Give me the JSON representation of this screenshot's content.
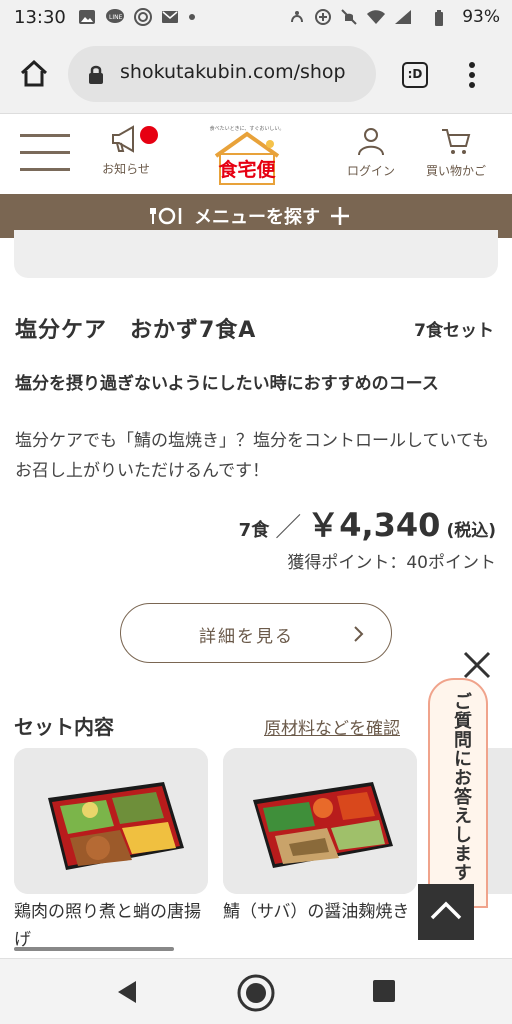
{
  "status_bar": {
    "time": "13:30",
    "battery": "93%"
  },
  "browser": {
    "url": "shokutakubin.com/shop",
    "tabs_label": ":D"
  },
  "header": {
    "notice_label": "お知らせ",
    "logo_text": "食宅便",
    "logo_tagline": "食べたいときに、すぐおいしい。",
    "login_label": "ログイン",
    "cart_label": "買い物かご",
    "menu_search_label": "メニューを探す"
  },
  "product": {
    "title": "塩分ケア　おかず7食A",
    "set_count": "7食セット",
    "lead": "塩分を摂り過ぎないようにしたい時におすすめのコース",
    "description": "塩分ケアでも「鯖の塩焼き」？塩分をコントロールしていてもお召し上がりいただけるんです！",
    "price_qty": "7食",
    "price_slash": "／",
    "price": "￥4,340",
    "price_tax": "(税込)",
    "points": "獲得ポイント：40ポイント",
    "detail_button": "詳細を見る"
  },
  "set_contents": {
    "title": "セット内容",
    "link": "原材料などを確認",
    "items": [
      {
        "name": "鶏肉の照り煮と蛸の唐揚げ"
      },
      {
        "name": "鯖（サバ）の醤油麹焼き"
      }
    ]
  },
  "faq": {
    "label": "ご質問にお答えします"
  },
  "colors": {
    "brand_brown": "#7a6652",
    "badge_red": "#e60012",
    "faq_border": "#f0a38b"
  }
}
